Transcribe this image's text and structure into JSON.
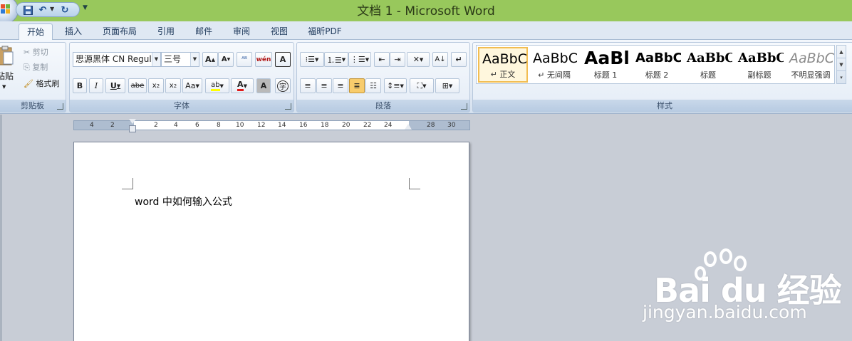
{
  "window": {
    "title": "文档 1 - Microsoft Word"
  },
  "quick_access": {
    "save_icon": "save-icon",
    "undo_icon": "undo-icon",
    "redo_icon": "redo-icon",
    "customize_icon": "customize-qat-icon"
  },
  "tabs": [
    {
      "label": "开始",
      "active": true
    },
    {
      "label": "插入"
    },
    {
      "label": "页面布局"
    },
    {
      "label": "引用"
    },
    {
      "label": "邮件"
    },
    {
      "label": "审阅"
    },
    {
      "label": "视图"
    },
    {
      "label": "福昕PDF"
    }
  ],
  "clipboard": {
    "paste_label": "粘贴",
    "cut_label": "剪切",
    "copy_label": "复制",
    "format_painter_label": "格式刷",
    "group_label": "剪贴板"
  },
  "font": {
    "name": "思源黑体 CN Regul",
    "size": "三号",
    "group_label": "字体"
  },
  "paragraph": {
    "group_label": "段落"
  },
  "styles": {
    "group_label": "样式",
    "items": [
      {
        "sample": "AaBbC",
        "name": "↵ 正文",
        "selected": true
      },
      {
        "sample": "AaBbC",
        "name": "↵ 无间隔"
      },
      {
        "sample": "AaBl",
        "name": "标题 1"
      },
      {
        "sample": "AaBbC",
        "name": "标题 2"
      },
      {
        "sample": "AaBbC",
        "name": "标题"
      },
      {
        "sample": "AaBbC",
        "name": "副标题"
      },
      {
        "sample": "AaBbC",
        "name": "不明显强调"
      }
    ]
  },
  "ruler": {
    "ticks": [
      "4",
      "2",
      "2",
      "4",
      "6",
      "8",
      "10",
      "12",
      "14",
      "16",
      "18",
      "20",
      "22",
      "24",
      "28",
      "30"
    ]
  },
  "document": {
    "text": "word 中如何输入公式"
  },
  "watermark": {
    "brand": "Bai du 经验",
    "url": "jingyan.baidu.com"
  },
  "colors": {
    "title_bar": "#98c85c",
    "ribbon": "#e1e9f4",
    "workspace": "#c8cdd6",
    "style_selected": "#f2bd52"
  }
}
